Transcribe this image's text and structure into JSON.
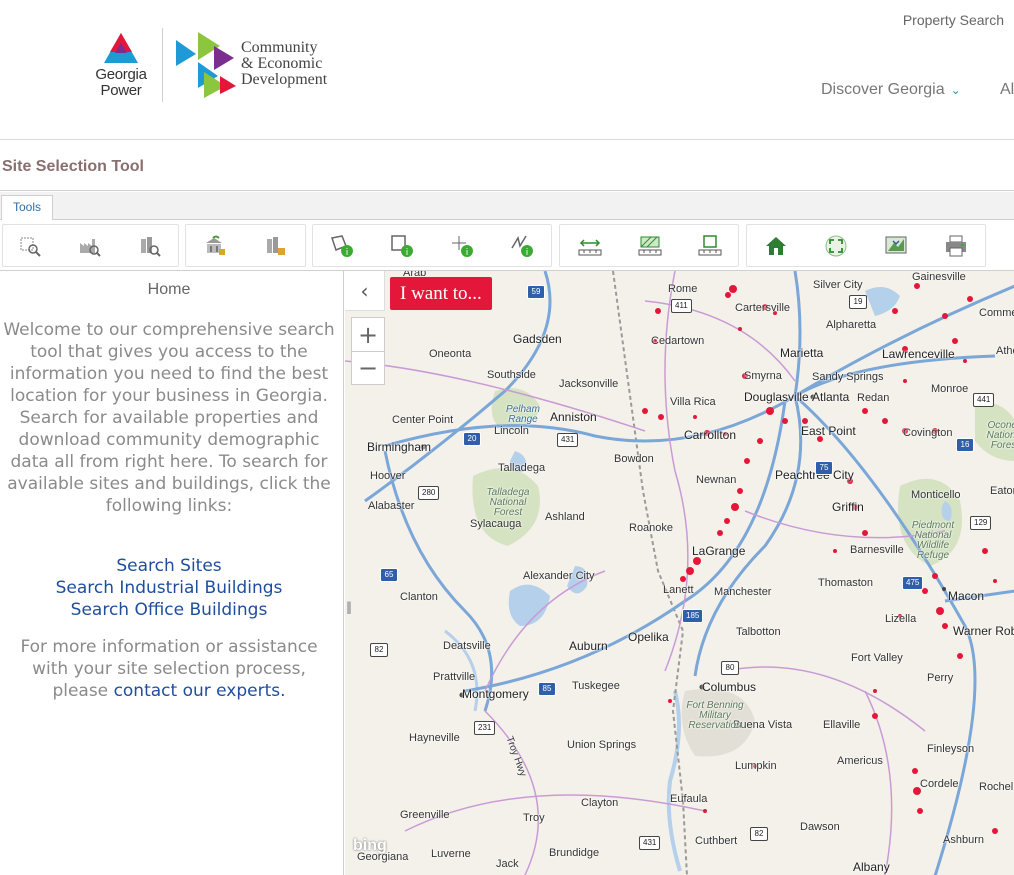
{
  "header": {
    "brand_left_lines": [
      "Georgia",
      "Power"
    ],
    "brand_right_lines": [
      "Community",
      "& Economic",
      "Development"
    ],
    "property_search": "Property Search",
    "nav": [
      {
        "label": "Discover Georgia"
      },
      {
        "label": "Al"
      }
    ],
    "colors": {
      "red": "#e4173a",
      "blue": "#1f9ad6",
      "green": "#8cc63f",
      "purple": "#7a2f8f"
    }
  },
  "app": {
    "title": "Site Selection Tool",
    "tabs": [
      {
        "label": "Tools",
        "active": true
      }
    ]
  },
  "toolbar": {
    "icons": [
      "parcel-search-icon",
      "industrial-search-icon",
      "building-search-icon",
      "community-icon",
      "demographic-icon",
      "identify-polygon-icon",
      "identify-rectangle-icon",
      "identify-point-icon",
      "identify-line-icon",
      "measure-distance-icon",
      "measure-area-icon",
      "measure-rectangle-icon",
      "home-icon",
      "full-extent-icon",
      "export-map-icon",
      "print-icon"
    ]
  },
  "panel": {
    "title": "Home",
    "intro": "Welcome to our comprehensive search tool that gives you access to the information you need to find the best location for your business in Georgia. Search for available properties and download community demographic data all from right here. To search for available sites and buildings, click the following links:",
    "links": [
      "Search Sites",
      "Search Industrial Buildings",
      "Search Office Buildings"
    ],
    "footer_prefix": "For more information or assistance with your site selection process, please ",
    "footer_link": "contact our experts."
  },
  "map": {
    "iwant": "I want to...",
    "zoom_in": "+",
    "zoom_out": "−",
    "collapse": "‹",
    "attribution": "bing",
    "labels": [
      "Arab",
      "Rome",
      "Cartersville",
      "Silver City",
      "Gainesville",
      "Commerce",
      "Gadsden",
      "Oneonta",
      "Cedartown",
      "Marietta",
      "Alpharetta",
      "Lawrenceville",
      "Athens",
      "Southside",
      "Jacksonville",
      "Smyrna",
      "Sandy Springs",
      "Monroe",
      "Center Point",
      "Anniston",
      "Villa Rica",
      "Douglasville",
      "Atlanta",
      "Redan",
      "Birmingham",
      "Lincoln",
      "Carrollton",
      "East Point",
      "Covington",
      "Talladega",
      "Bowdon",
      "Newnan",
      "Peachtree City",
      "Hoover",
      "Alabaster",
      "Sylacauga",
      "Ashland",
      "Roanoke",
      "Griffin",
      "Monticello",
      "Eatonton",
      "LaGrange",
      "Barnesville",
      "Alexander City",
      "Manchester",
      "Thomaston",
      "Clanton",
      "Lanett",
      "Macon",
      "Opelika",
      "Auburn",
      "Talbotton",
      "Lizella",
      "Warner Robins",
      "Deatsville",
      "Prattville",
      "Montgomery",
      "Tuskegee",
      "Columbus",
      "Fort Valley",
      "Perry",
      "Hayneville",
      "Buena Vista",
      "Ellaville",
      "Union Springs",
      "Lumpkin",
      "Americus",
      "Finleyson",
      "Cordele",
      "Rochelle",
      "Clayton",
      "Eufaula",
      "Troy",
      "Greenville",
      "Dawson",
      "Cuthbert",
      "Ashburn",
      "Luverne",
      "Brundidge",
      "Jack",
      "Albany",
      "Georgiana"
    ],
    "park_labels": [
      "Pelham Range",
      "Talladega National Forest",
      "Fort Benning Military Reservation",
      "Piedmont National Wildlife Refuge",
      "Oconee National Forest"
    ],
    "road_label": "Troy Hwy",
    "shields": [
      "59",
      "411",
      "19",
      "441",
      "20",
      "431",
      "85",
      "280",
      "65",
      "185",
      "82",
      "80",
      "231",
      "475",
      "75",
      "129",
      "16",
      "82",
      "431"
    ]
  }
}
